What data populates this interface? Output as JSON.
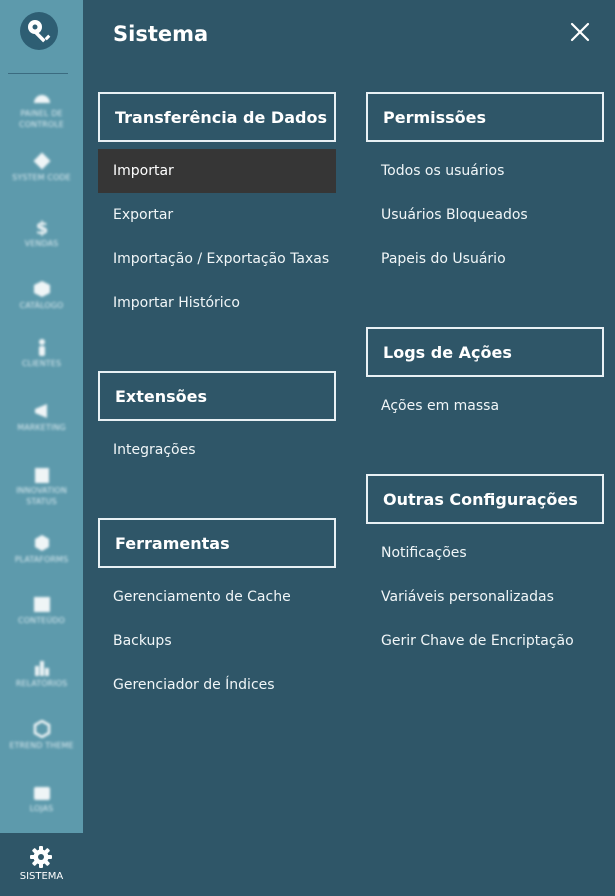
{
  "panel": {
    "title": "Sistema",
    "columns": [
      [
        {
          "id": "transferencia",
          "title": "Transferência de Dados",
          "items": [
            "Importar",
            "Exportar",
            "Importação / Exportação Taxas",
            "Importar Histórico"
          ],
          "active_item": "Importar"
        },
        {
          "id": "extensoes",
          "title": "Extensões",
          "items": [
            "Integrações"
          ]
        },
        {
          "id": "ferramentas",
          "title": "Ferramentas",
          "items": [
            "Gerenciamento de Cache",
            "Backups",
            "Gerenciador de Índices"
          ]
        }
      ],
      [
        {
          "id": "permissoes",
          "title": "Permissões",
          "items": [
            "Todos os usuários",
            "Usuários Bloqueados",
            "Papeis do Usuário"
          ]
        },
        {
          "id": "logs",
          "title": "Logs de Ações",
          "items": [
            "Ações em massa"
          ]
        },
        {
          "id": "outras",
          "title": "Outras Configurações",
          "items": [
            "Notificações",
            "Variáveis personalizadas",
            "Gerir Chave de Encriptação"
          ]
        }
      ]
    ]
  },
  "rail": {
    "items": [
      {
        "label": "PAINEL DE CONTROLE",
        "icon": "dashboard-icon"
      },
      {
        "label": "SYSTEM CODE",
        "icon": "tag-icon"
      },
      {
        "label": "VENDAS",
        "icon": "dollar-icon"
      },
      {
        "label": "CATÁLOGO",
        "icon": "cube-icon"
      },
      {
        "label": "CLIENTES",
        "icon": "person-icon"
      },
      {
        "label": "MARKETING",
        "icon": "megaphone-icon"
      },
      {
        "label": "INNOVATION STATUS",
        "icon": "building-icon"
      },
      {
        "label": "PLATAFORMS",
        "icon": "hexagon-icon"
      },
      {
        "label": "CONTEÚDO",
        "icon": "layout-icon"
      },
      {
        "label": "RELATÓRIOS",
        "icon": "bar-chart-icon"
      },
      {
        "label": "ETREND THEME",
        "icon": "hexagon-outline-icon"
      },
      {
        "label": "LOJAS",
        "icon": "store-icon"
      }
    ],
    "active": {
      "label": "SISTEMA",
      "icon": "gear-icon"
    }
  },
  "colors": {
    "panel_bg": "#2f5668",
    "rail_bg": "#5d9aac",
    "active_item_bg": "#363636",
    "text": "#ffffff"
  }
}
